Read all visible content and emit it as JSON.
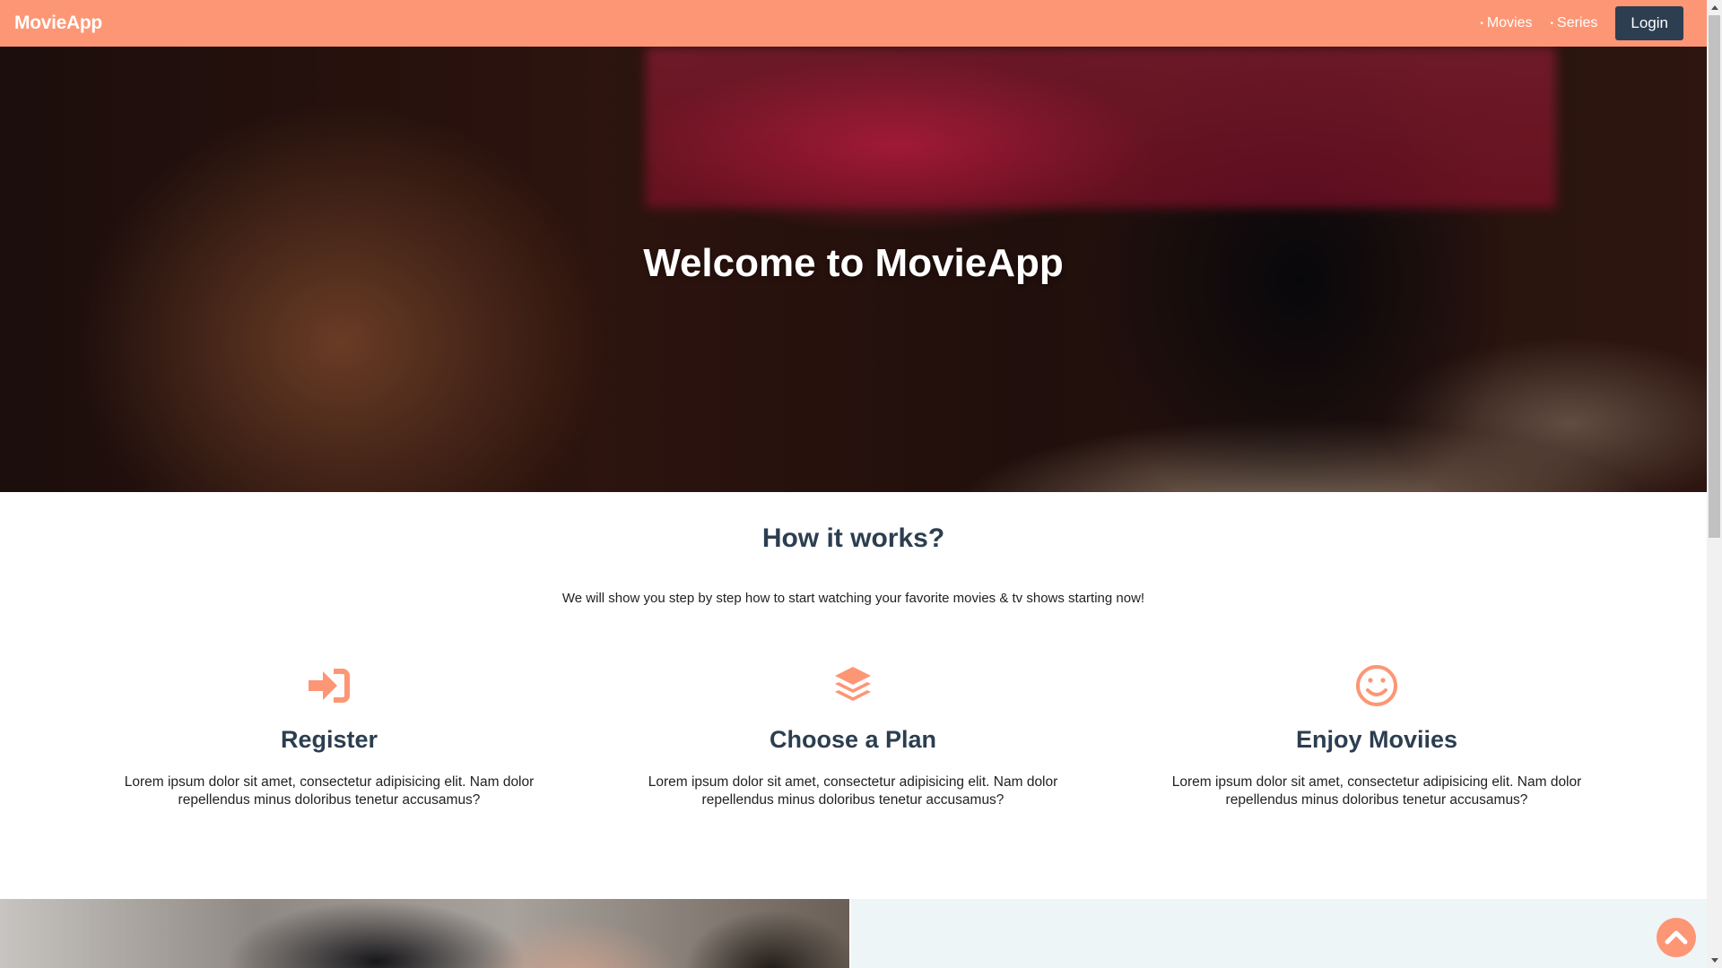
{
  "colors": {
    "accent": "#fd9675",
    "navbar_bg": "#fd9675",
    "login_bg": "#2c3e50",
    "heading": "#2c3e50",
    "bottom_panel": "#eef5f6"
  },
  "navbar": {
    "brand": "MovieApp",
    "links": [
      {
        "bullet": "•",
        "label": "Movies"
      },
      {
        "bullet": "•",
        "label": "Series"
      }
    ],
    "login_label": "Login"
  },
  "hero": {
    "title": "Welcome to MovieApp"
  },
  "how_it_works": {
    "title": "How it works?",
    "subtitle": "We will show you step by step how to start watching your favorite movies & tv shows starting now!",
    "steps": [
      {
        "icon": "sign-in-icon",
        "title": "Register",
        "text": "Lorem ipsum dolor sit amet, consectetur adipisicing elit. Nam dolor repellendus minus doloribus tenetur accusamus?"
      },
      {
        "icon": "layers-icon",
        "title": "Choose a Plan",
        "text": "Lorem ipsum dolor sit amet, consectetur adipisicing elit. Nam dolor repellendus minus doloribus tenetur accusamus?"
      },
      {
        "icon": "smile-icon",
        "title": "Enjoy Moviies",
        "text": "Lorem ipsum dolor sit amet, consectetur adipisicing elit. Nam dolor repellendus minus doloribus tenetur accusamus?"
      }
    ]
  },
  "scroll_top": {
    "icon": "chevron-up-icon"
  }
}
